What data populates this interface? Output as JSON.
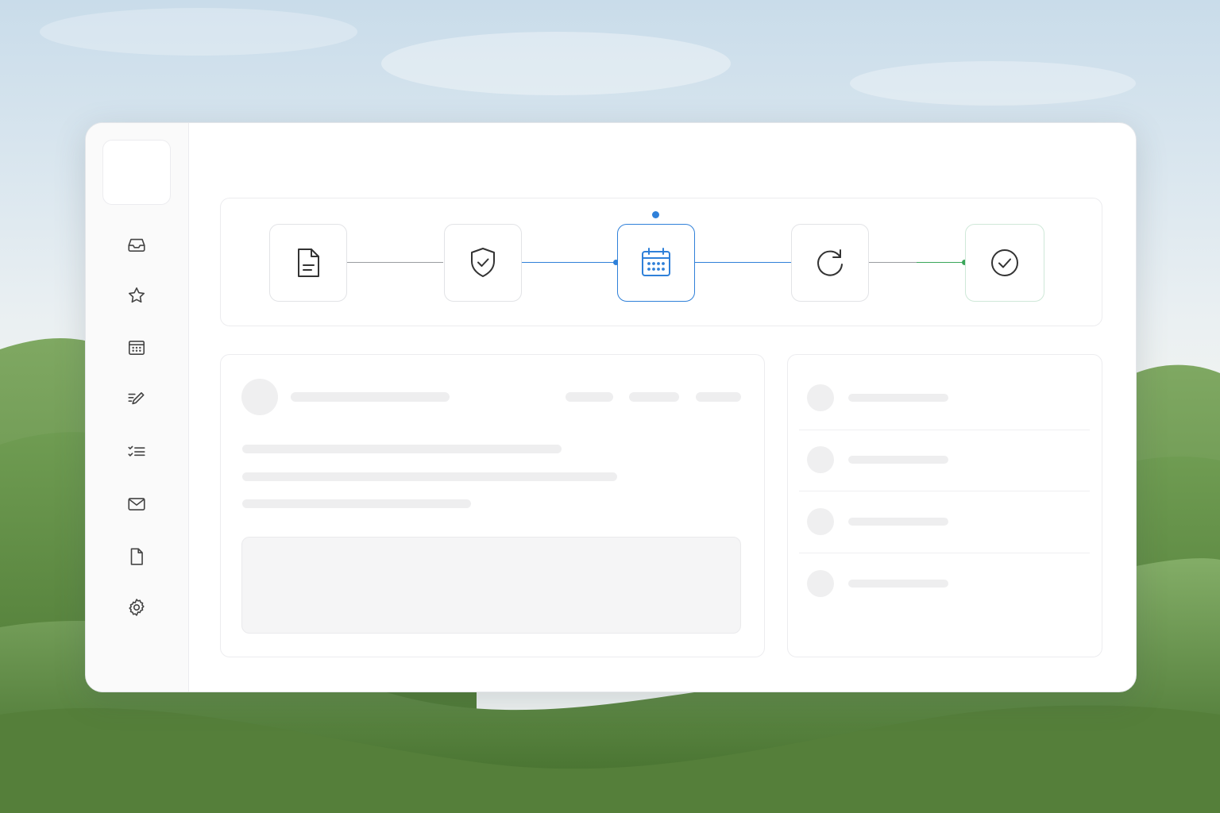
{
  "theme": {
    "accent": "#2f80d9",
    "success": "#3aa65a",
    "icon_stroke": "#333333",
    "skeleton": "#eeeeef"
  },
  "sidebar": {
    "items": [
      {
        "id": "inbox",
        "icon": "inbox-icon"
      },
      {
        "id": "favorites",
        "icon": "star-icon"
      },
      {
        "id": "calendar",
        "icon": "calendar-icon"
      },
      {
        "id": "notes",
        "icon": "edit-list-icon"
      },
      {
        "id": "tasks",
        "icon": "checklist-icon"
      },
      {
        "id": "mail",
        "icon": "mail-icon"
      },
      {
        "id": "documents",
        "icon": "document-icon"
      },
      {
        "id": "settings",
        "icon": "gear-icon"
      }
    ]
  },
  "workflow": {
    "steps": [
      {
        "id": "document",
        "icon": "document-icon",
        "state": "default"
      },
      {
        "id": "verify",
        "icon": "shield-check-icon",
        "state": "default"
      },
      {
        "id": "schedule",
        "icon": "calendar-icon",
        "state": "active"
      },
      {
        "id": "sync",
        "icon": "refresh-icon",
        "state": "default"
      },
      {
        "id": "complete",
        "icon": "check-circle-icon",
        "state": "done"
      }
    ]
  }
}
